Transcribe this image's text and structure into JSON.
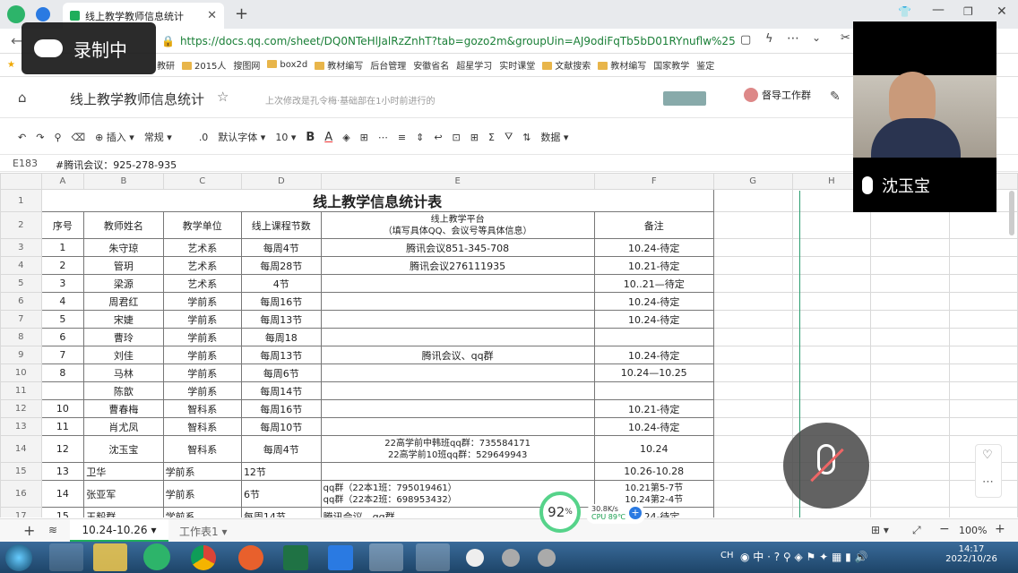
{
  "browser": {
    "tab_title": "线上教学教师信息统计",
    "url": "https://docs.qq.com/sheet/DQ0NTeHlJalRzZnhT?tab=gozo2m&groupUin=AJ9odiFqTb5bD01RYnuflw%25253D",
    "bookmarks": [
      "教研",
      "2015人",
      "搜图网",
      "box2d",
      "教材编写",
      "后台管理",
      "安徽省名",
      "超星学习",
      "实时课堂",
      "文献搜索",
      "教材编写",
      "国家教学",
      "鉴定"
    ]
  },
  "doc": {
    "title": "线上教学教师信息统计",
    "last_edit": "上次修改是孔令梅·基础部在1小时前进行的",
    "share_label": "督导工作群"
  },
  "toolbar": {
    "insert": "插入",
    "format": "常规",
    "decimal": ".0",
    "font": "默认字体",
    "font_size": "10",
    "bold": "B",
    "font_color": "A",
    "data": "数据"
  },
  "formula": {
    "cell_ref": "E183",
    "content": "#腾讯会议：925-278-935"
  },
  "grid": {
    "col_headers": [
      "A",
      "B",
      "C",
      "D",
      "E",
      "F",
      "G",
      "H",
      "I",
      "J"
    ],
    "title": "线上教学信息统计表",
    "header": [
      "序号",
      "教师姓名",
      "教学单位",
      "线上课程节数",
      "线上教学平台\n（填写具体QQ、会议号等具体信息）",
      "备注"
    ],
    "rows": [
      {
        "r": "3",
        "c": [
          "1",
          "朱守琼",
          "艺术系",
          "每周4节",
          "腾讯会议851-345-708",
          "10.24-待定"
        ]
      },
      {
        "r": "4",
        "c": [
          "2",
          "管玥",
          "艺术系",
          "每周28节",
          "腾讯会议276111935",
          "10.21-待定"
        ]
      },
      {
        "r": "5",
        "c": [
          "3",
          "梁源",
          "艺术系",
          "4节",
          "",
          "10..21—待定"
        ]
      },
      {
        "r": "6",
        "c": [
          "4",
          "周君红",
          "学前系",
          "每周16节",
          "",
          "10.24-待定"
        ]
      },
      {
        "r": "7",
        "c": [
          "5",
          "宋婕",
          "学前系",
          "每周13节",
          "",
          "10.24-待定"
        ]
      },
      {
        "r": "8",
        "c": [
          "6",
          "曹玲",
          "学前系",
          "每周18",
          "",
          ""
        ]
      },
      {
        "r": "9",
        "c": [
          "7",
          "刘佳",
          "学前系",
          "每周13节",
          "腾讯会议、qq群",
          "10.24-待定"
        ]
      },
      {
        "r": "10",
        "c": [
          "8",
          "马林",
          "学前系",
          "每周6节",
          "",
          "10.24—10.25"
        ]
      },
      {
        "r": "11",
        "c": [
          "",
          "陈歆",
          "学前系",
          "每周14节",
          "",
          ""
        ]
      },
      {
        "r": "12",
        "c": [
          "10",
          "曹春梅",
          "智科系",
          "每周16节",
          "",
          "10.21-待定"
        ]
      },
      {
        "r": "13",
        "c": [
          "11",
          "肖尤凤",
          "智科系",
          "每周10节",
          "",
          "10.24-待定"
        ]
      },
      {
        "r": "14",
        "c": [
          "12",
          "沈玉宝",
          "智科系",
          "每周4节",
          "22高学前中韩班qq群：735584171\n22高学前10班qq群：529649943",
          "10.24"
        ]
      },
      {
        "r": "15",
        "c": [
          "13",
          "卫华",
          "学前系",
          "12节",
          "",
          "10.26-10.28"
        ]
      },
      {
        "r": "16",
        "c": [
          "14",
          "张亚军",
          "学前系",
          "6节",
          "qq群（22本1班：795019461）\nqq群（22本2班：698953432）",
          "10.21第5-7节\n10.24第2-4节"
        ]
      },
      {
        "r": "17",
        "c": [
          "15",
          "王毅群",
          "学前系",
          "每周14节",
          "腾讯会议、qq群",
          "10.24-待定"
        ]
      }
    ]
  },
  "sheets": {
    "active": "10.24-10.26",
    "other": "工作表1",
    "zoom": "100%"
  },
  "overlay": {
    "recording": "录制中",
    "speaker": "沈玉宝",
    "cpu_percent": "92",
    "pct_sign": "%",
    "net_speed": "30.8K/s",
    "cpu_temp": "CPU 89℃"
  },
  "taskbar": {
    "time": "14:17",
    "date": "2022/10/26",
    "ime": "CH"
  }
}
